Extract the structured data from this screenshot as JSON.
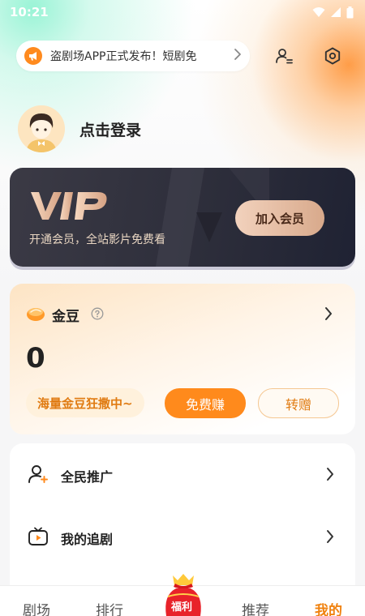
{
  "status": {
    "time": "10:21"
  },
  "notice": {
    "text": "盗剧场APP正式发布！短剧免"
  },
  "profile": {
    "login_label": "点击登录"
  },
  "vip": {
    "logo_text": "VIP",
    "subtitle": "开通会员，全站影片免费看",
    "join_label": "加入会员"
  },
  "coins": {
    "title": "金豆",
    "value": "0",
    "slogan": "海量金豆狂撒中~",
    "earn_label": "免费赚",
    "gift_label": "转赠"
  },
  "menu": {
    "items": [
      {
        "label": "全民推广",
        "icon": "user-plus-icon"
      },
      {
        "label": "我的追剧",
        "icon": "tv-play-icon"
      }
    ]
  },
  "tabs": [
    {
      "label": "剧场"
    },
    {
      "label": "排行"
    },
    {
      "label": "福利"
    },
    {
      "label": "推荐"
    },
    {
      "label": "我的"
    }
  ],
  "colors": {
    "accent": "#ff8a1c",
    "vip_bg": "#2c2d3a",
    "active_tab": "#f0820f"
  }
}
